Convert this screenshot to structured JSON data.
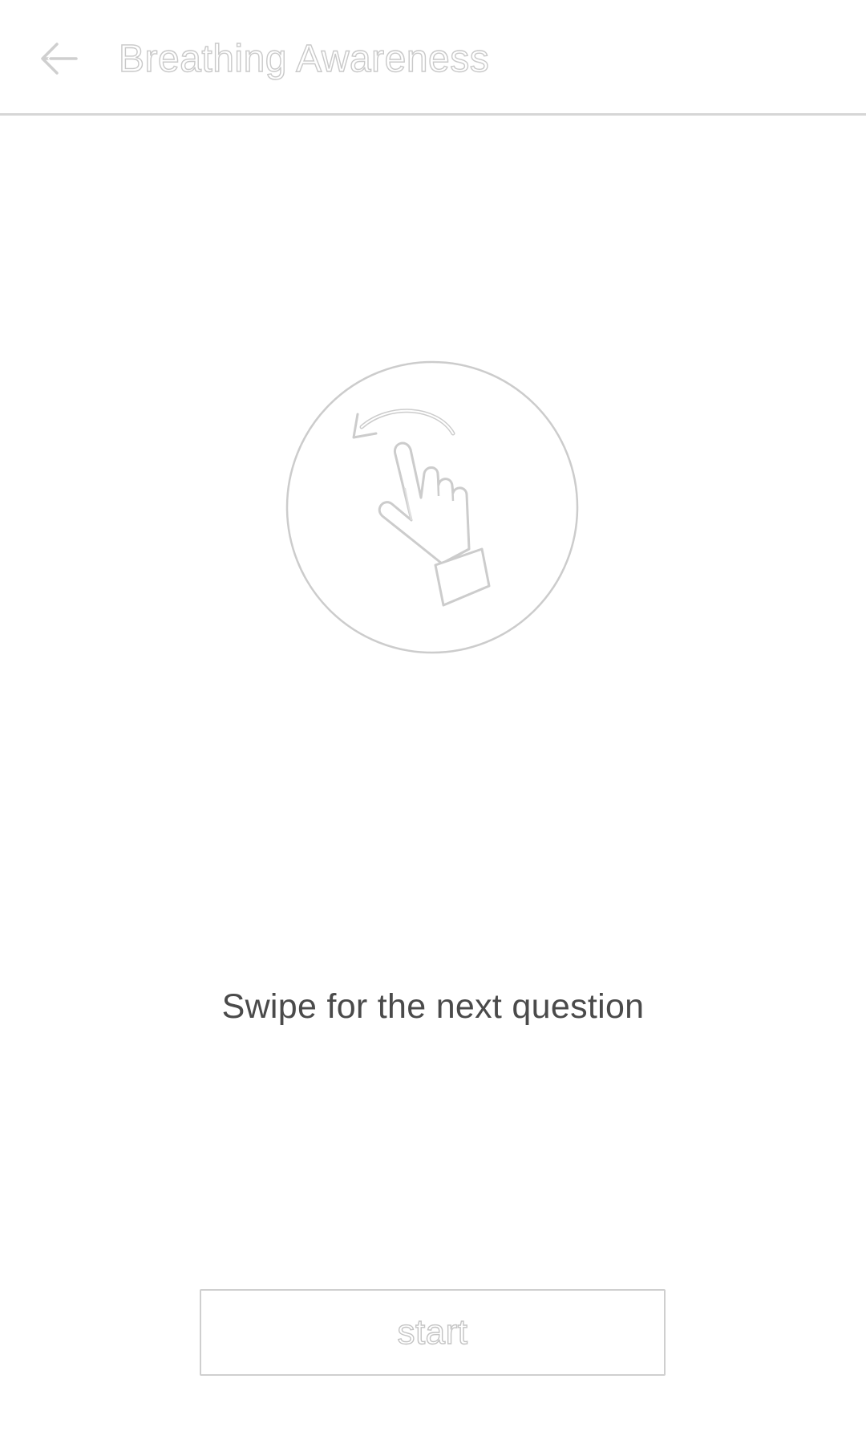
{
  "app_bar": {
    "title": "Breathing Awareness",
    "back_icon": "arrow-left-icon"
  },
  "illustration": {
    "icon": "swipe-hand-icon"
  },
  "instruction": {
    "text": "Swipe for the next question"
  },
  "actions": {
    "start_label": "start"
  },
  "colors": {
    "outline": "#c9c9c9",
    "text": "#4a4a4a",
    "divider": "#d6d6d6",
    "background": "#ffffff"
  }
}
